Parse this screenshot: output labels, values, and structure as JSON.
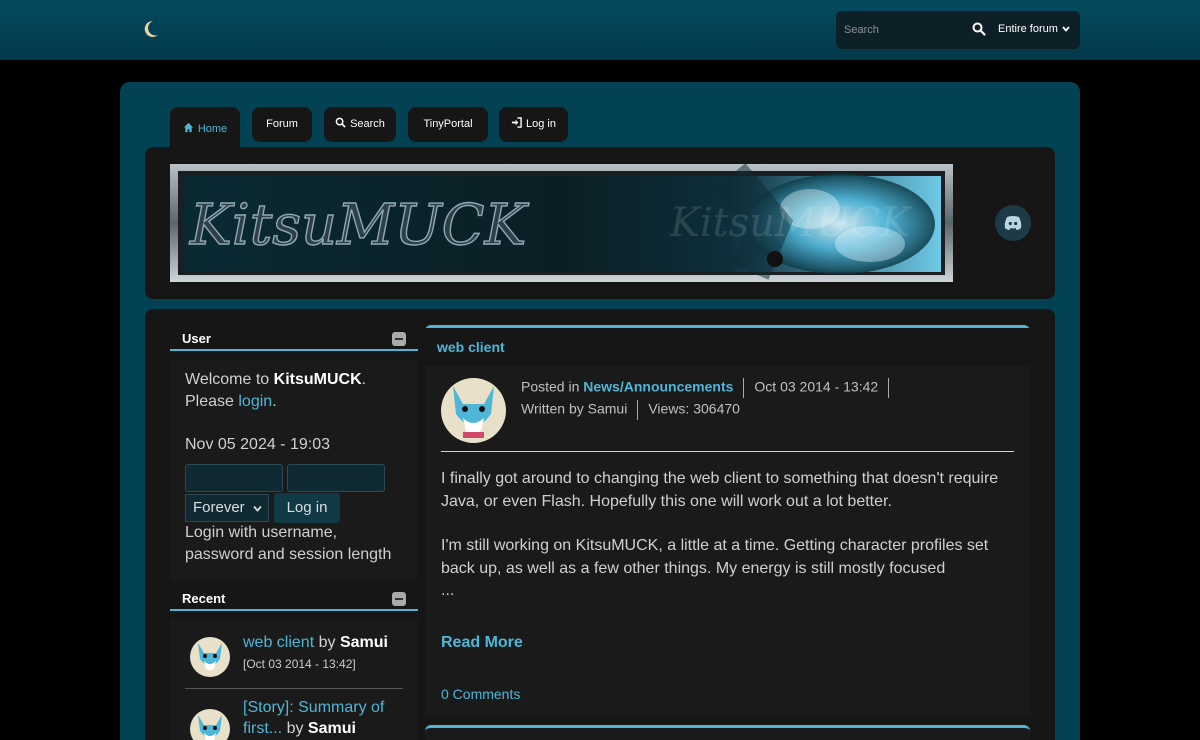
{
  "search": {
    "placeholder": "Search",
    "scope_selected": "Entire forum"
  },
  "tabs": [
    {
      "label": "Home",
      "icon": "home-icon"
    },
    {
      "label": "Forum"
    },
    {
      "label": "Search",
      "icon": "search-icon"
    },
    {
      "label": "TinyPortal"
    },
    {
      "label": "Log in",
      "icon": "login-icon"
    }
  ],
  "banner": {
    "logo_text": "KitsuMUCK"
  },
  "user_block": {
    "title": "User",
    "welcome_prefix": "Welcome to",
    "site_name": "KitsuMUCK",
    "welcome_suffix": ".",
    "please": "Please",
    "login_link": "login",
    "login_suffix": ".",
    "datetime": "Nov 05 2024 - 19:03",
    "session_length_selected": "Forever",
    "login_button": "Log in",
    "login_hint": "Login with username, password and session length"
  },
  "recent_block": {
    "title": "Recent",
    "items": [
      {
        "title": "web client",
        "by": "by",
        "author": "Samui",
        "date": "[Oct 03 2014 - 13:42]"
      },
      {
        "title": "[Story]: Summary of first...",
        "by": "by",
        "author": "Samui"
      }
    ]
  },
  "article": {
    "title": "web client",
    "posted_in_label": "Posted in",
    "category": "News/Announcements",
    "date": "Oct 03 2014 - 13:42",
    "written_by": "Written by Samui",
    "views": "Views: 306470",
    "paragraph1": "I finally got around to changing the web client to something that doesn't require Java, or even Flash. Hopefully this one will work out a lot better.",
    "paragraph2": "I'm still working on KitsuMUCK, a little at a time. Getting character profiles set back up, as well as a few other things. My energy is still mostly focused",
    "ellipsis": "...",
    "read_more": "Read More",
    "comments": "0 Comments"
  },
  "colors": {
    "accent": "#4fb6d8",
    "topbar": "#044b5f",
    "wrapper": "#034253",
    "panel": "#161616"
  }
}
